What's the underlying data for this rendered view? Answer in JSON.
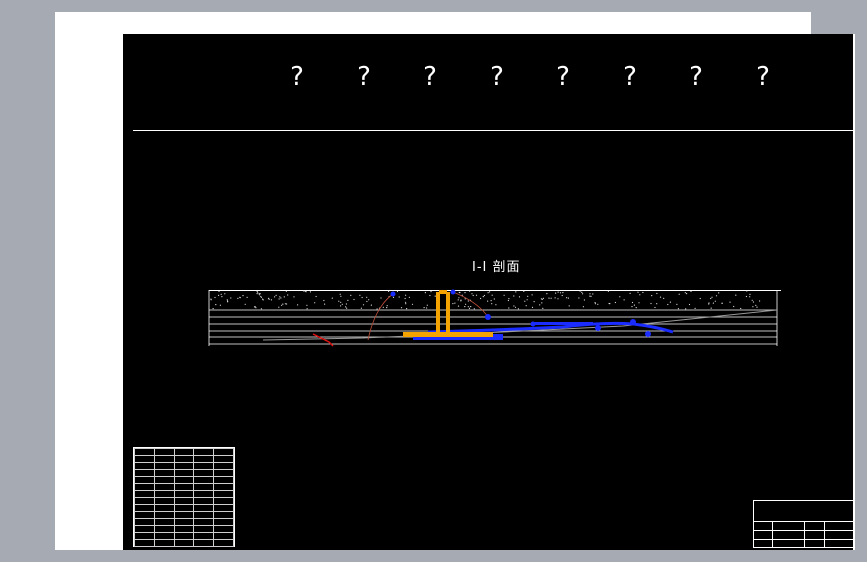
{
  "header": {
    "placeholders": [
      "?",
      "?",
      "?",
      "?",
      "?",
      "?",
      "?",
      "?"
    ]
  },
  "section": {
    "title": "I-I 剖面"
  },
  "colors": {
    "background_outer": "#a5aab3",
    "sheet": "#ffffff",
    "drawing": "#000000",
    "accent_orange": "#f5a300",
    "accent_blue": "#1a2cff",
    "accent_red": "#e01010"
  },
  "icons": {
    "profile": "cross-section-profile-drawing"
  }
}
